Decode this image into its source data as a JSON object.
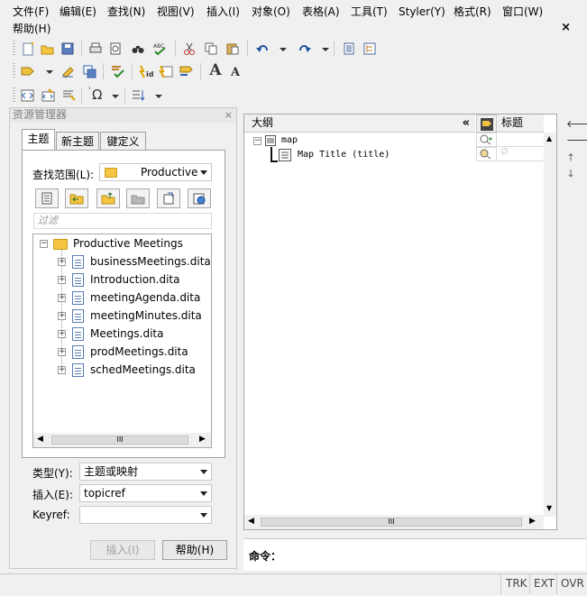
{
  "menubar": {
    "items": [
      "文件(F)",
      "编辑(E)",
      "查找(N)",
      "视图(V)",
      "插入(I)",
      "对象(O)",
      "表格(A)",
      "工具(T)",
      "Styler(Y)",
      "格式(R)",
      "窗口(W)"
    ],
    "help": "帮助(H)",
    "close": "×"
  },
  "toolbar": {
    "font_up": "A",
    "font_down": "A",
    "omega": "Ω"
  },
  "resource_manager": {
    "title": "资源管理器",
    "close": "×",
    "tabs": [
      "主题",
      "新主题",
      "键定义"
    ],
    "search_label": "查找范围(L):",
    "search_value": "Productive",
    "filter_placeholder": "过滤",
    "tree": {
      "root": "Productive Meetings",
      "items": [
        "businessMeetings.ditamap",
        "Introduction.dita",
        "meetingAgenda.dita",
        "meetingMinutes.dita",
        "Meetings.dita",
        "prodMeetings.dita",
        "schedMeetings.dita"
      ]
    },
    "scroll_thumb": "III",
    "type_label": "类型(Y):",
    "type_value": "主题或映射",
    "insert_label": "插入(E):",
    "insert_value": "topicref",
    "keyref_label": "Keyref:",
    "keyref_value": "",
    "insert_button": "插入(I)",
    "help_button": "帮助(H)"
  },
  "outline": {
    "title": "大纲",
    "collapse": "«",
    "col_title": "标题",
    "root": "map",
    "child": "Map Title (title)",
    "scroll_thumb": "III"
  },
  "command": {
    "label": "命令："
  },
  "status": {
    "items": [
      "TRK",
      "EXT",
      "OVR"
    ]
  }
}
